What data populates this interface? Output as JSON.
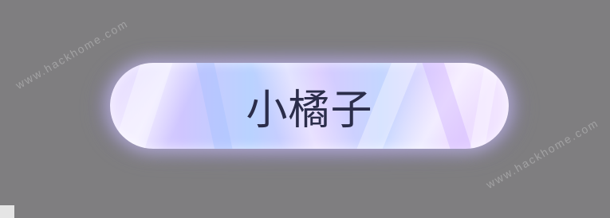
{
  "name_plate": {
    "text": "小橘子"
  },
  "watermarks": [
    "www.hackhome.com",
    "www.hackhome.com"
  ],
  "colors": {
    "background": "#7f7e80",
    "text": "#2b2d4a",
    "plate_light": "#e8dcff",
    "plate_blue": "#b9d2ff"
  }
}
